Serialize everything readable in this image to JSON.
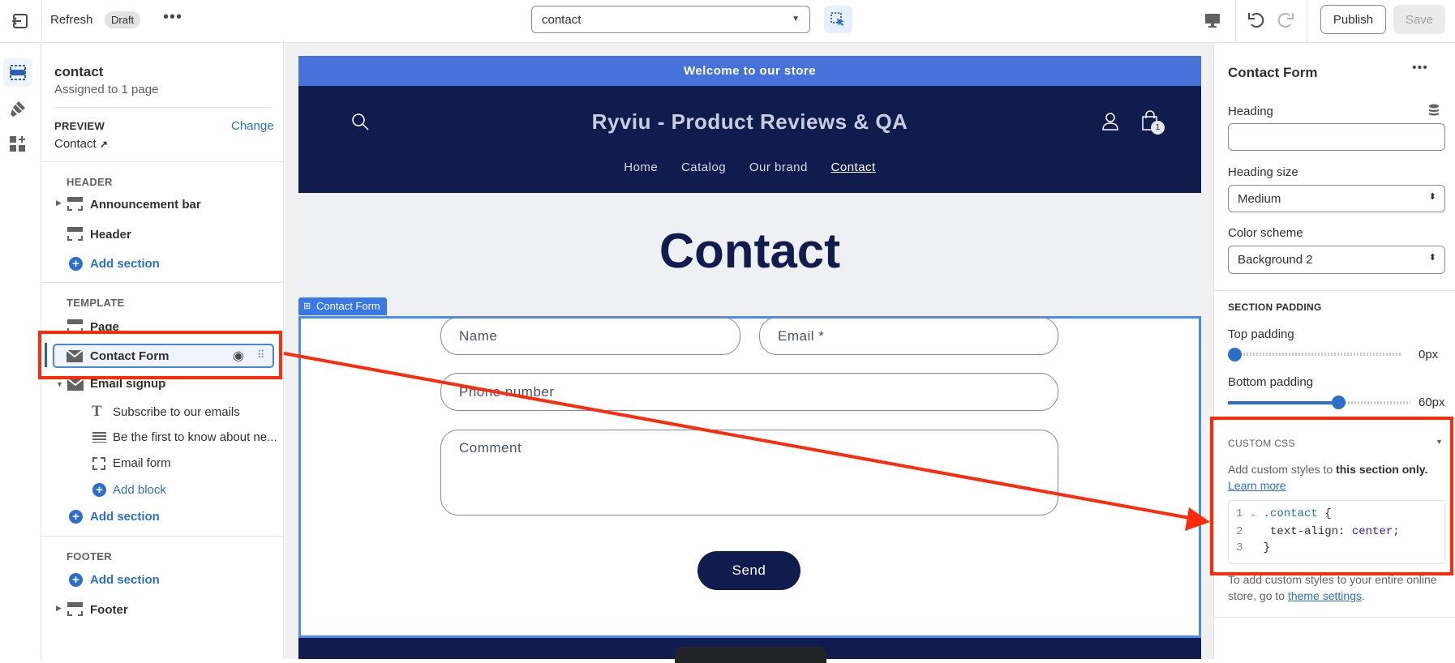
{
  "topbar": {
    "refresh": "Refresh",
    "status": "Draft",
    "template_select": "contact",
    "publish": "Publish",
    "save": "Save"
  },
  "left": {
    "title": "contact",
    "subtitle": "Assigned to 1 page",
    "preview_label": "PREVIEW",
    "change": "Change",
    "preview_page": "Contact",
    "header_label": "HEADER",
    "announcement": "Announcement bar",
    "header": "Header",
    "add_section": "Add section",
    "template_label": "TEMPLATE",
    "page": "Page",
    "contact_form": "Contact Form",
    "email_signup": "Email signup",
    "blocks": [
      "Subscribe to our emails",
      "Be the first to know about ne...",
      "Email form"
    ],
    "add_block": "Add block",
    "footer_label": "FOOTER",
    "footer": "Footer"
  },
  "store": {
    "announcement": "Welcome to our store",
    "brand": "Ryviu - Product Reviews & QA",
    "nav": [
      "Home",
      "Catalog",
      "Our brand",
      "Contact"
    ],
    "cart_count": "1",
    "page_title": "Contact",
    "section_tag": "Contact Form",
    "fields": {
      "name": "Name",
      "email": "Email *",
      "phone": "Phone number",
      "comment": "Comment"
    },
    "send": "Send"
  },
  "right": {
    "title": "Contact Form",
    "heading_label": "Heading",
    "heading_value": "",
    "heading_size_label": "Heading size",
    "heading_size": "Medium",
    "color_scheme_label": "Color scheme",
    "color_scheme": "Background 2",
    "padding_label": "SECTION PADDING",
    "top_padding_label": "Top padding",
    "top_padding": "0px",
    "top_padding_value": 0,
    "bottom_padding_label": "Bottom padding",
    "bottom_padding": "60px",
    "bottom_padding_value": 60,
    "css_label": "CUSTOM CSS",
    "css_desc": "Add custom styles to ",
    "css_desc_bold": "this section only.",
    "learn_more": "Learn more",
    "code": [
      {
        "n": "1",
        "sel": ".contact",
        "rest": " {"
      },
      {
        "n": "2",
        "prop": "text-align: ",
        "val": "center",
        "end": ";"
      },
      {
        "n": "3",
        "rest": "}"
      }
    ],
    "footer_text": "To add custom styles to your entire online store, go to ",
    "theme_settings": "theme settings",
    "footer_end": "."
  },
  "colors": {
    "accent": "#2c6ecb",
    "store_navy": "#0f1c4d",
    "announcement": "#4672d9",
    "annotation": "#ff2a0a"
  }
}
